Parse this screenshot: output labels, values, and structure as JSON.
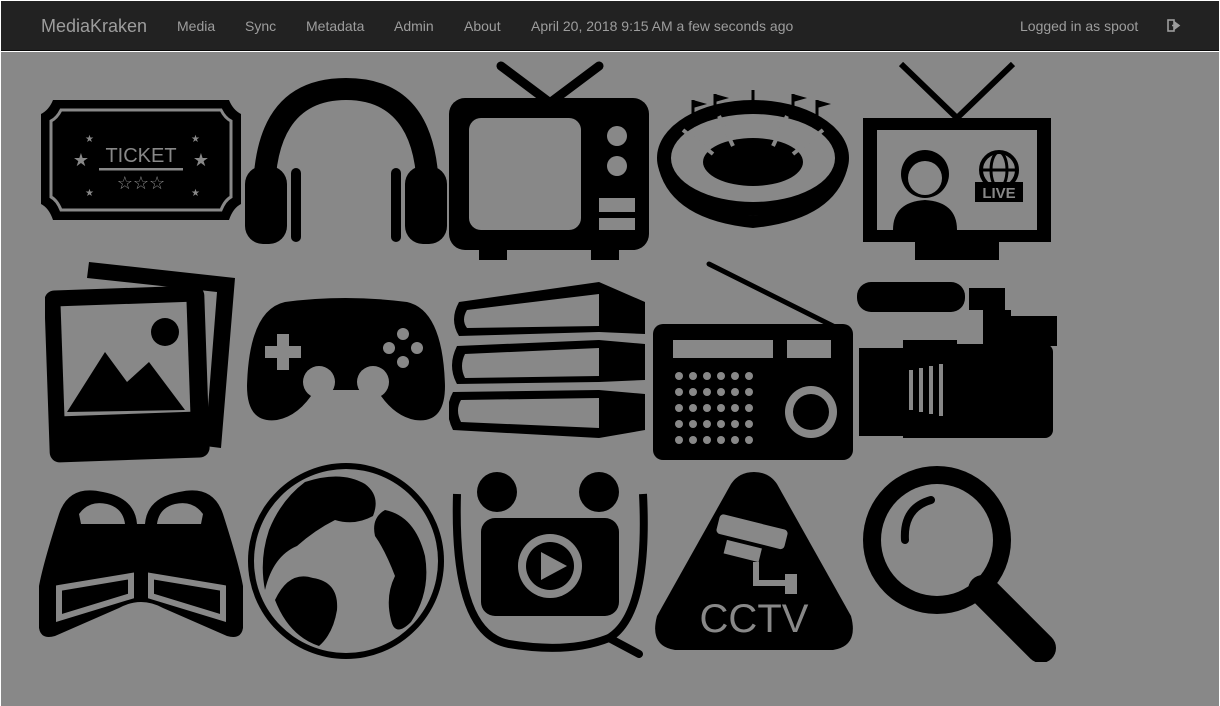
{
  "navbar": {
    "brand": "MediaKraken",
    "items": [
      {
        "label": "Media"
      },
      {
        "label": "Sync"
      },
      {
        "label": "Metadata"
      },
      {
        "label": "Admin"
      },
      {
        "label": "About"
      }
    ],
    "datetime": "April 20, 2018 9:15 AM a few seconds ago",
    "user_text": "Logged in as spoot",
    "logout_icon": "sign-out-icon"
  },
  "tiles": {
    "ticket": {
      "text": "TICKET",
      "icon": "ticket-icon"
    },
    "music": {
      "icon": "headphones-icon"
    },
    "tv": {
      "icon": "television-icon"
    },
    "sports": {
      "icon": "stadium-icon"
    },
    "live": {
      "text": "LIVE",
      "icon": "live-news-tv-icon"
    },
    "pictures": {
      "icon": "photos-icon"
    },
    "games": {
      "icon": "gamepad-icon"
    },
    "books": {
      "icon": "books-icon"
    },
    "radio": {
      "icon": "radio-icon"
    },
    "video": {
      "icon": "video-camera-icon"
    },
    "threed": {
      "icon": "3d-glasses-icon"
    },
    "globe": {
      "icon": "globe-icon"
    },
    "media_player": {
      "icon": "media-player-headphones-icon"
    },
    "cctv": {
      "text": "CCTV",
      "icon": "cctv-camera-icon"
    },
    "search": {
      "icon": "magnifier-icon"
    }
  },
  "colors": {
    "navbar_bg": "#222222",
    "navbar_text": "#9d9d9d",
    "content_bg": "#888888",
    "icon_fill": "#000000"
  }
}
